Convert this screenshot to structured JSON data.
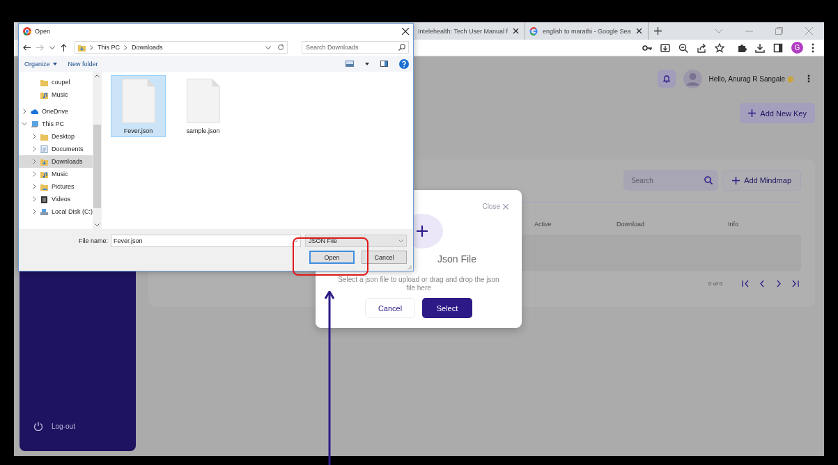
{
  "browser": {
    "tabs": [
      {
        "title": "Intelehealth: Tech User Manual f",
        "kind": "page",
        "selected": false
      },
      {
        "title": "english to marathi - Google Sea",
        "kind": "google",
        "selected": false
      }
    ],
    "profile_initial": "G"
  },
  "app": {
    "sidebar": {
      "logout": "Log-out"
    },
    "header": {
      "greeting": "Hello, Anurag R Sangale"
    },
    "add_key_button": "Add New Key",
    "panel": {
      "search": {
        "placeholder": "Search"
      },
      "add_button": "Add Mindmap",
      "columns": [
        "Active",
        "Download",
        "Info"
      ],
      "pagination": "0 of 0"
    }
  },
  "modal": {
    "close": "Close",
    "title": "Json File",
    "description": "Select a json file to upload or drag and drop the json file here",
    "buttons": [
      {
        "label": "Cancel",
        "kind": "secondary"
      },
      {
        "label": "Select",
        "kind": "primary"
      }
    ]
  },
  "file_dialog": {
    "title": "Open",
    "breadcrumb": [
      "This PC",
      "Downloads"
    ],
    "search": {
      "placeholder": "Search Downloads"
    },
    "toolbar": {
      "organize": "Organize",
      "new_folder": "New folder"
    },
    "quick_access": [
      {
        "label": "coupel",
        "kind": "folder",
        "selected": false
      },
      {
        "label": "Music",
        "kind": "music",
        "selected": false
      }
    ],
    "nav_tree": [
      {
        "label": "OneDrive",
        "kind": "cloud",
        "selected": false,
        "expanded": false
      },
      {
        "label": "This PC",
        "kind": "pc",
        "selected": false,
        "expanded": true,
        "children": [
          {
            "label": "Desktop",
            "kind": "folder",
            "selected": false,
            "expanded": false
          },
          {
            "label": "Documents",
            "kind": "documents",
            "selected": false,
            "expanded": false
          },
          {
            "label": "Downloads",
            "kind": "downloads",
            "selected": true,
            "expanded": false
          },
          {
            "label": "Music",
            "kind": "music",
            "selected": false,
            "expanded": false
          },
          {
            "label": "Pictures",
            "kind": "pictures",
            "selected": false,
            "expanded": false
          },
          {
            "label": "Videos",
            "kind": "videos",
            "selected": false,
            "expanded": false
          },
          {
            "label": "Local Disk (C:)",
            "kind": "drive",
            "selected": false,
            "expanded": false
          }
        ]
      }
    ],
    "files": [
      {
        "name": "Fever.json",
        "selected": true
      },
      {
        "name": "sample.json",
        "selected": false
      }
    ],
    "file_name_label": "File name:",
    "file_name": "Fever.json",
    "file_type": "JSON File",
    "buttons": [
      {
        "label": "Open",
        "focused": true
      },
      {
        "label": "Cancel",
        "focused": false
      }
    ]
  }
}
